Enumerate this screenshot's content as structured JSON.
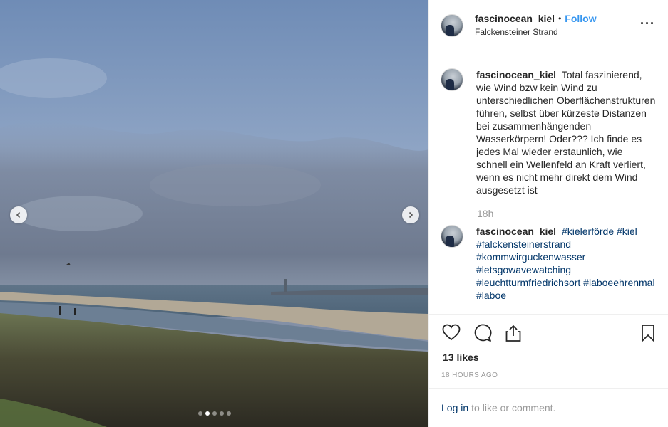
{
  "post": {
    "username": "fascinocean_kiel",
    "separator": "•",
    "follow_label": "Follow",
    "location": "Falckensteiner Strand",
    "more_icon": "more-options-icon"
  },
  "caption": {
    "username": "fascinocean_kiel",
    "text": "Total faszinierend, wie Wind bzw kein Wind zu unterschiedlichen Oberflächenstrukturen führen, selbst über kürzeste Distanzen bei zusammenhängenden Wasserkörpern! Oder??? Ich finde es jedes Mal wieder erstaunlich, wie schnell ein Wellenfeld an Kraft verliert, wenn es nicht mehr direkt dem Wind ausgesetzt ist",
    "time": "18h"
  },
  "hashtag_comment": {
    "username": "fascinocean_kiel",
    "tags": [
      "#kielerförde",
      "#kiel",
      "#falckensteinerstrand",
      "#kommwirguckenwasser",
      "#letsgowavewatching",
      "#leuchtturmfriedrichsort",
      "#laboeehrenmal",
      "#laboe"
    ]
  },
  "carousel": {
    "slide_count": 5,
    "active_slide": 2
  },
  "stats": {
    "likes": "13 likes",
    "time_ago": "18 HOURS AGO"
  },
  "footer": {
    "login_label": "Log in",
    "rest": "to like or comment."
  },
  "colors": {
    "link_blue": "#3897f0",
    "hashtag_blue": "#003569",
    "muted_gray": "#999999"
  }
}
